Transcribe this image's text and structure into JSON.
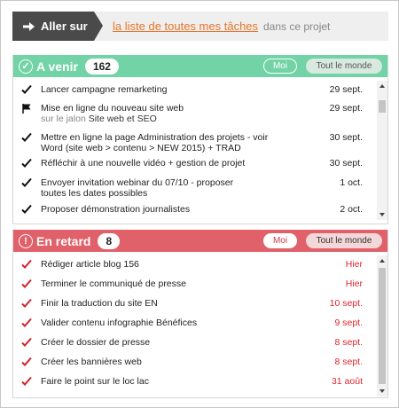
{
  "nav": {
    "goto_label": "Aller sur",
    "link_label": "la liste de toutes mes tâches",
    "context_label": "dans ce projet"
  },
  "upcoming": {
    "title": "A venir",
    "count": "162",
    "filter_me": "Moi",
    "filter_all": "Tout le monde",
    "tasks": [
      {
        "title": "Lancer campagne remarketing",
        "date": "29 sept.",
        "icon": "check-icon"
      },
      {
        "title": "Mise en ligne du nouveau site web",
        "sub_prefix": "sur le jalon",
        "sub_value": "Site web et SEO",
        "date": "29 sept.",
        "icon": "flag-icon"
      },
      {
        "title": "Mettre en ligne la page Administration des projets - voir Word (site web > contenu > NEW 2015) + TRAD",
        "date": "30 sept.",
        "icon": "check-icon"
      },
      {
        "title": "Réfléchir à une nouvelle vidéo + gestion de projet",
        "date": "30 sept.",
        "icon": "check-icon"
      },
      {
        "title": "Envoyer invitation webinar du 07/10 - proposer toutes les dates possibles",
        "date": "1 oct.",
        "icon": "check-icon"
      },
      {
        "title": "Proposer démonstration journalistes",
        "date": "2 oct.",
        "icon": "check-icon"
      }
    ]
  },
  "late": {
    "title": "En retard",
    "count": "8",
    "filter_me": "Moi",
    "filter_all": "Tout le monde",
    "tasks": [
      {
        "title": "Rédiger article blog 156",
        "date": "Hier"
      },
      {
        "title": "Terminer le communiqué de presse",
        "date": "Hier"
      },
      {
        "title": "Finir la traduction du site EN",
        "date": "10 sept."
      },
      {
        "title": "Valider contenu infographie Bénéfices",
        "date": "9 sept."
      },
      {
        "title": "Créer le dossier de presse",
        "date": "8 sept."
      },
      {
        "title": "Créer les bannières web",
        "date": "8 sept."
      },
      {
        "title": "Faire le point sur le loc lac",
        "date": "31 août"
      }
    ]
  },
  "colors": {
    "upcoming_accent": "#72d3a6",
    "late_accent": "#e0616a",
    "link": "#e8742a",
    "late_date": "#e0242f"
  }
}
